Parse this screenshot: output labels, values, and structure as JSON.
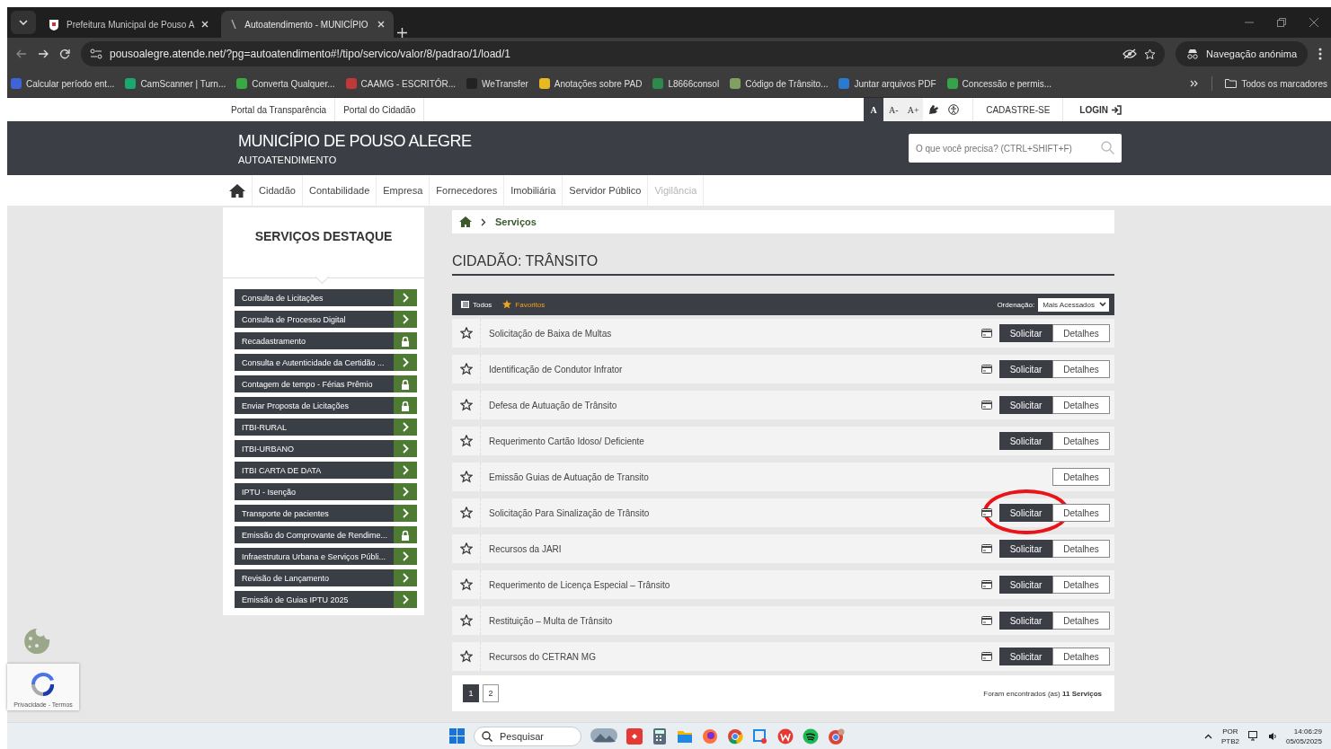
{
  "browser": {
    "tabs": [
      {
        "title": "Prefeitura Municipal de Pouso A",
        "selected": false
      },
      {
        "title": "Autoatendimento - MUNICÍPIO",
        "selected": true
      }
    ],
    "url": "pousoalegre.atende.net/?pg=autoatendimento#!/tipo/servico/valor/8/padrao/1/load/1",
    "profile": "Navegação anónima",
    "bookmarks": [
      {
        "label": "Calcular período ent...",
        "color": "#3f63d8"
      },
      {
        "label": "CamScanner | Turn...",
        "color": "#1aa870"
      },
      {
        "label": "Converta Qualquer...",
        "color": "#3aa845"
      },
      {
        "label": "CAAMG - ESCRITÓR...",
        "color": "#c03838"
      },
      {
        "label": "WeTransfer",
        "color": "#222222"
      },
      {
        "label": "Anotações sobre PAD",
        "color": "#e8b820"
      },
      {
        "label": "L8666consol",
        "color": "#2d8a4a"
      },
      {
        "label": "Código de Trânsito...",
        "color": "#7fa060"
      },
      {
        "label": "Juntar arquivos PDF",
        "color": "#2a7bd0"
      },
      {
        "label": "Concessão e permis...",
        "color": "#36a24a"
      }
    ],
    "all_bookmarks": "Todos os marcadores"
  },
  "page": {
    "top_links": [
      "Portal da Transparência",
      "Portal do Cidadão"
    ],
    "font_controls": [
      {
        "label": "A",
        "selected": true
      },
      {
        "label": "A-",
        "selected": false
      },
      {
        "label": "A+",
        "selected": false
      }
    ],
    "register": "CADASTRE-SE",
    "login": "LOGIN",
    "site_title": "MUNICÍPIO DE POUSO ALEGRE",
    "site_subtitle": "AUTOATENDIMENTO",
    "search": {
      "placeholder": "O que você precisa? (CTRL+SHIFT+F)"
    },
    "nav": [
      {
        "label": "Cidadão",
        "disabled": false
      },
      {
        "label": "Contabilidade",
        "disabled": false
      },
      {
        "label": "Empresa",
        "disabled": false
      },
      {
        "label": "Fornecedores",
        "disabled": false
      },
      {
        "label": "Imobiliária",
        "disabled": false
      },
      {
        "label": "Servidor Público",
        "disabled": false
      },
      {
        "label": "Vigilância",
        "disabled": true
      }
    ],
    "sidebar": {
      "title": "SERVIÇOS DESTAQUE",
      "items": [
        {
          "label": "Consulta de Licitações",
          "kind": "arrow"
        },
        {
          "label": "Consulta de Processo Digital",
          "kind": "arrow"
        },
        {
          "label": "Recadastramento",
          "kind": "lock"
        },
        {
          "label": "Consulta e Autenticidade da Certidão ...",
          "kind": "arrow"
        },
        {
          "label": "Contagem de tempo - Férias Prêmio",
          "kind": "lock"
        },
        {
          "label": "Enviar Proposta de Licitações",
          "kind": "lock"
        },
        {
          "label": "ITBI-RURAL",
          "kind": "arrow"
        },
        {
          "label": "ITBI-URBANO",
          "kind": "arrow"
        },
        {
          "label": "ITBI CARTA DE DATA",
          "kind": "arrow"
        },
        {
          "label": "IPTU - Isenção",
          "kind": "arrow"
        },
        {
          "label": "Transporte de pacientes",
          "kind": "arrow"
        },
        {
          "label": "Emissão do Comprovante de Rendime...",
          "kind": "lock"
        },
        {
          "label": "Infraestrutura Urbana e Serviços Públi...",
          "kind": "arrow"
        },
        {
          "label": "Revisão de Lançamento",
          "kind": "arrow"
        },
        {
          "label": "Emissão de Guias IPTU 2025",
          "kind": "arrow"
        }
      ]
    },
    "breadcrumb": "Serviços",
    "section_title": "CIDADÃO: TRÂNSITO",
    "filters": [
      {
        "label": "Todos",
        "kind": "all"
      },
      {
        "label": "Favoritos",
        "kind": "favorites"
      }
    ],
    "sort": {
      "label": "Ordenação:",
      "value": "Mais Acessados"
    },
    "services": [
      {
        "name": "Solicitação de Baixa de Multas",
        "card": true,
        "request": "Solicitar",
        "details": "Detalhes",
        "circled": false
      },
      {
        "name": "Identificação de Condutor Infrator",
        "card": true,
        "request": "Solicitar",
        "details": "Detalhes",
        "circled": false
      },
      {
        "name": "Defesa de Autuação de Trânsito",
        "card": true,
        "request": "Solicitar",
        "details": "Detalhes",
        "circled": false
      },
      {
        "name": "Requerimento Cartão Idoso/ Deficiente",
        "card": false,
        "request": "Solicitar",
        "details": "Detalhes",
        "circled": false
      },
      {
        "name": "Emissão Guias de Autuação de Transito",
        "card": false,
        "details": "Detalhes",
        "circled": false
      },
      {
        "name": "Solicitação Para Sinalização de Trânsito",
        "card": true,
        "request": "Solicitar",
        "details": "Detalhes",
        "circled": true
      },
      {
        "name": "Recursos da JARI",
        "card": true,
        "request": "Solicitar",
        "details": "Detalhes",
        "circled": false
      },
      {
        "name": "Requerimento de Licença Especial – Trânsito",
        "card": true,
        "request": "Solicitar",
        "details": "Detalhes",
        "circled": false
      },
      {
        "name": "Restituição – Multa de Trânsito",
        "card": true,
        "request": "Solicitar",
        "details": "Detalhes",
        "circled": false
      },
      {
        "name": "Recursos do CETRAN MG",
        "card": true,
        "request": "Solicitar",
        "details": "Detalhes",
        "circled": false
      }
    ],
    "pagination": [
      {
        "label": "1",
        "selected": true
      },
      {
        "label": "2",
        "selected": false
      }
    ],
    "result_text": "Foram encontrados (as) **11 Serviços**",
    "recaptcha": "Privacidade - Termos"
  },
  "taskbar": {
    "search": "Pesquisar",
    "language": "POR",
    "layout": "PTB2",
    "time": "14:06:29",
    "date": "05/05/2025"
  }
}
